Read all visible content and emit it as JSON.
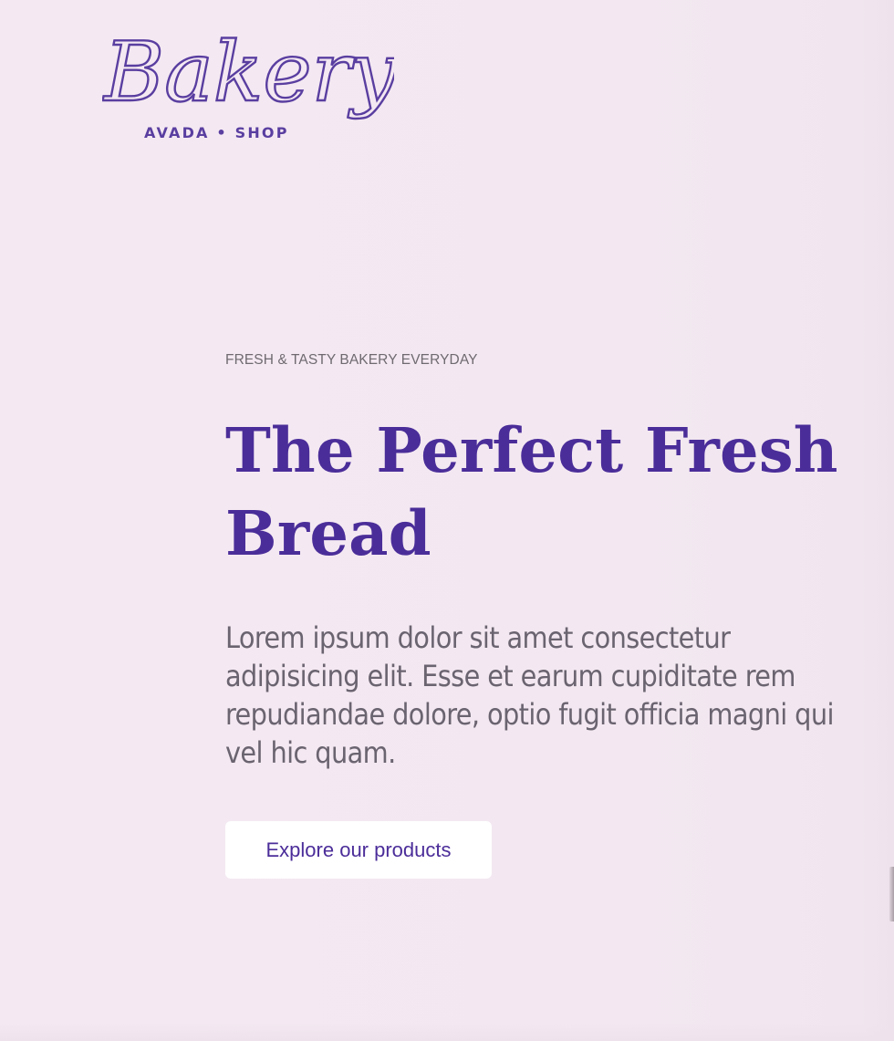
{
  "brand": {
    "script_name": "Bakery",
    "tagline": "AVADA • SHOP",
    "color": "#5a3ea0"
  },
  "hero": {
    "eyebrow": "FRESH & TASTY BAKERY EVERYDAY",
    "headline_line1": "The Perfect Fresh",
    "headline_line2": "Bread",
    "lead": "Lorem ipsum dolor sit amet consectetur adipisicing elit. Esse et earum cupiditate rem repudiandae dolore, optio fugit officia magni qui vel hic quam.",
    "cta_label": "Explore our products",
    "heading_color": "#4b2d99",
    "background_color": "#f3e8f1"
  }
}
